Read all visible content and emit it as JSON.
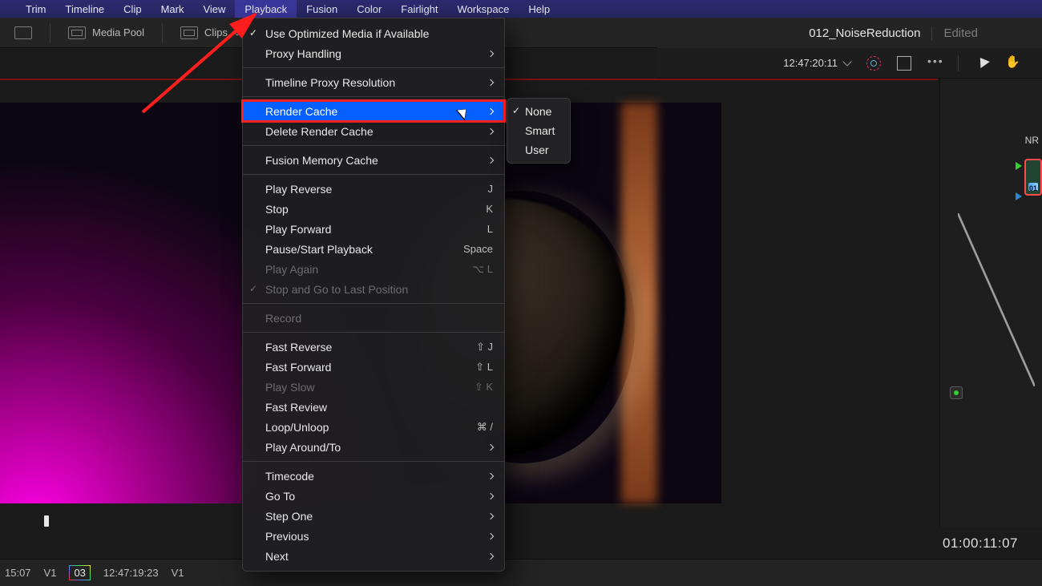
{
  "menubar": {
    "items": [
      "Trim",
      "Timeline",
      "Clip",
      "Mark",
      "View",
      "Playback",
      "Fusion",
      "Color",
      "Fairlight",
      "Workspace",
      "Help"
    ],
    "active": "Playback"
  },
  "toolbar": {
    "media_pool": "Media Pool",
    "clips": "Clips"
  },
  "header": {
    "title": "012_NoiseReduction",
    "status": "Edited",
    "timecode": "12:47:20:11"
  },
  "dropdown": {
    "items": [
      {
        "label": "Use Optimized Media if Available",
        "checked": true
      },
      {
        "label": "Proxy Handling",
        "submenu": true
      },
      {
        "sep": true
      },
      {
        "label": "Timeline Proxy Resolution",
        "submenu": true
      },
      {
        "sep": true
      },
      {
        "label": "Render Cache",
        "submenu": true,
        "highlight": true
      },
      {
        "label": "Delete Render Cache",
        "submenu": true
      },
      {
        "sep": true
      },
      {
        "label": "Fusion Memory Cache",
        "submenu": true
      },
      {
        "sep": true
      },
      {
        "label": "Play Reverse",
        "short": "J"
      },
      {
        "label": "Stop",
        "short": "K"
      },
      {
        "label": "Play Forward",
        "short": "L"
      },
      {
        "label": "Pause/Start Playback",
        "short": "Space"
      },
      {
        "label": "Play Again",
        "short": "⌥ L",
        "disabled": true
      },
      {
        "label": "Stop and Go to Last Position",
        "checked": true,
        "disabled": true
      },
      {
        "sep": true
      },
      {
        "label": "Record",
        "disabled": true
      },
      {
        "sep": true
      },
      {
        "label": "Fast Reverse",
        "short": "⇧ J"
      },
      {
        "label": "Fast Forward",
        "short": "⇧ L"
      },
      {
        "label": "Play Slow",
        "short": "⇧ K",
        "disabled": true
      },
      {
        "label": "Fast Review"
      },
      {
        "label": "Loop/Unloop",
        "short": "⌘ /"
      },
      {
        "label": "Play Around/To",
        "submenu": true
      },
      {
        "sep": true
      },
      {
        "label": "Timecode",
        "submenu": true
      },
      {
        "label": "Go To",
        "submenu": true
      },
      {
        "label": "Step One",
        "submenu": true
      },
      {
        "label": "Previous",
        "submenu": true
      },
      {
        "label": "Next",
        "submenu": true
      }
    ]
  },
  "submenu": {
    "items": [
      {
        "label": "None",
        "checked": true
      },
      {
        "label": "Smart"
      },
      {
        "label": "User"
      }
    ]
  },
  "viewer": {
    "big_timecode": "01:00:11:07"
  },
  "bottom": {
    "tc_left": "15:07",
    "track": "V1",
    "clipnum": "03",
    "tc_mid": "12:47:19:23",
    "track2": "V1"
  },
  "nodes": {
    "label": "NR",
    "nodenum": "01"
  }
}
